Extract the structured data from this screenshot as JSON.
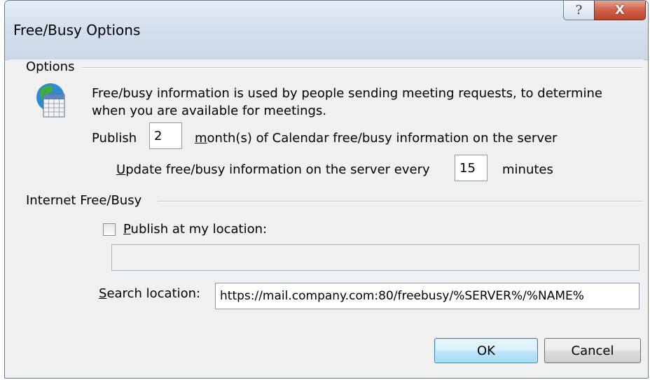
{
  "window": {
    "title": "Free/Busy Options",
    "help_symbol": "?",
    "close_symbol": "X"
  },
  "options_group": {
    "label": "Options",
    "description_line1": "Free/busy information is used by people sending meeting requests, to determine",
    "description_line2": "when you are available for meetings.",
    "publish_label": "Publish",
    "publish_months": "2",
    "months_label_mnemonic": "m",
    "months_label_rest": "onth(s) of Calendar free/busy information on the server",
    "update_label_mnemonic": "U",
    "update_label_rest": "pdate free/busy information on the server every",
    "update_minutes": "15",
    "minutes_label": "minutes"
  },
  "internet_group": {
    "label": "Internet Free/Busy",
    "publish_location_mnemonic": "P",
    "publish_location_rest": "ublish at my location:",
    "publish_location_checked": false,
    "publish_location_value": "",
    "search_location_mnemonic": "S",
    "search_location_rest": "earch location:",
    "search_location_value": "https://mail.company.com:80/freebusy/%SERVER%/%NAME%"
  },
  "buttons": {
    "ok": "OK",
    "cancel": "Cancel"
  },
  "colors": {
    "close_button": "#c7472f",
    "default_button_border": "#3c7fb1"
  },
  "icons": {
    "calendar": "globe-calendar-icon",
    "help": "help-icon",
    "close": "close-icon"
  }
}
